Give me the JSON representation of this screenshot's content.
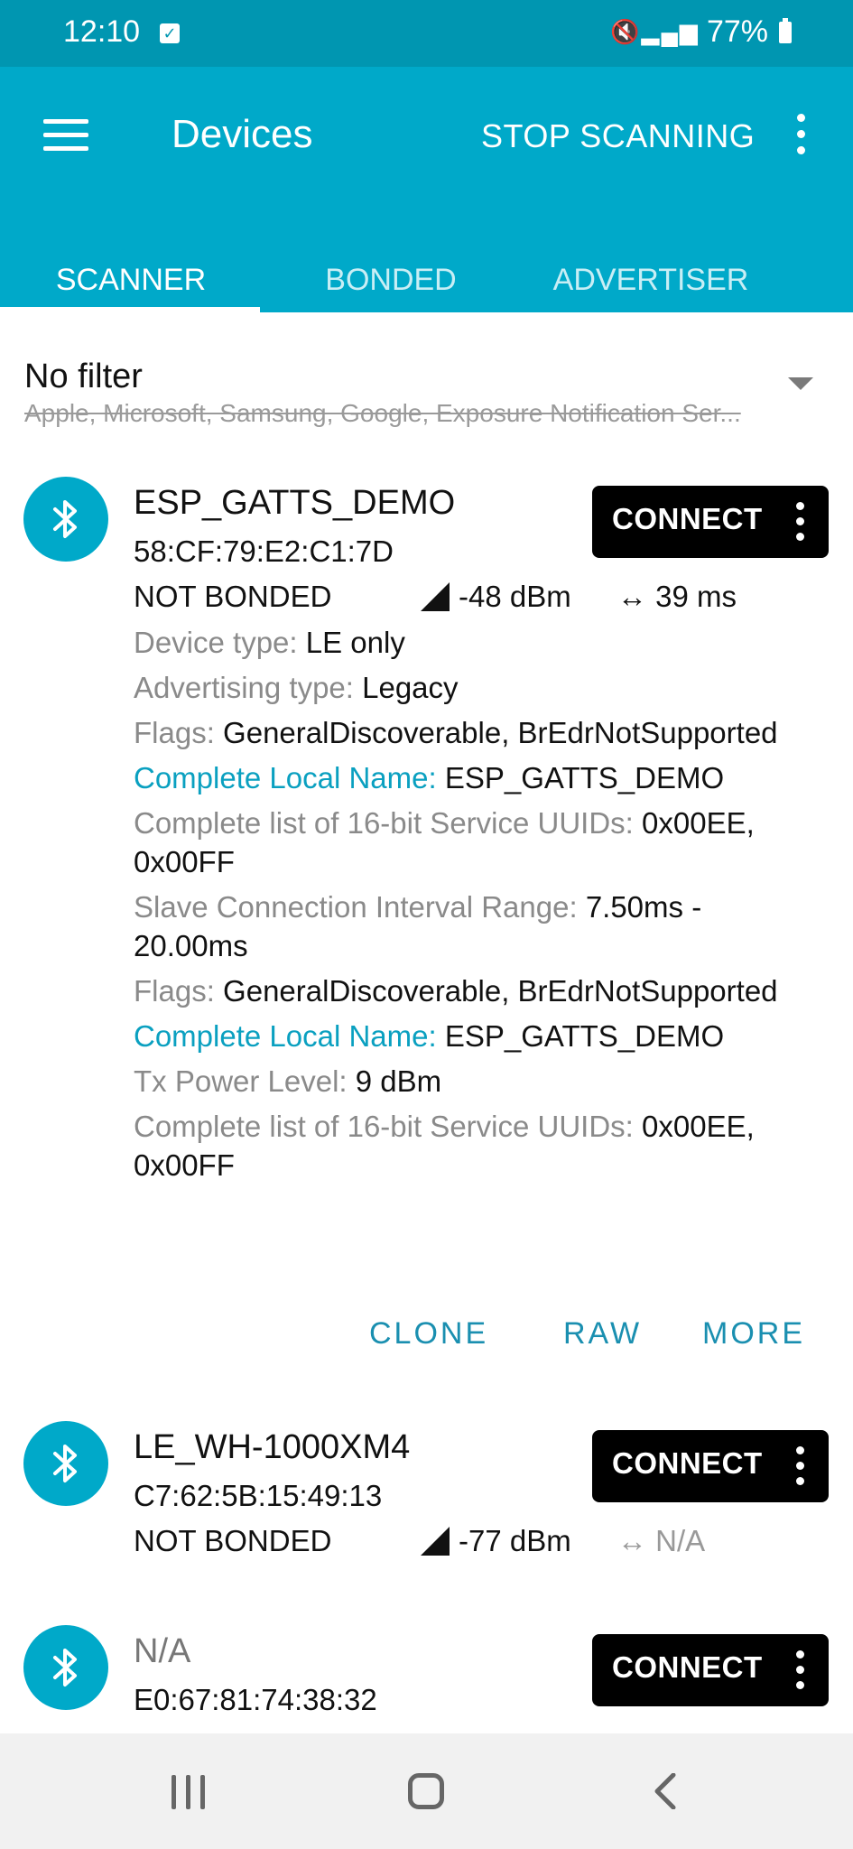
{
  "status_bar": {
    "time": "12:10",
    "battery": "77%",
    "icons": [
      "checkbox-notification-icon",
      "vibrate-mute-icon",
      "signal-icon",
      "battery-icon"
    ]
  },
  "app_bar": {
    "title": "Devices",
    "stop_scanning_label": "STOP SCANNING",
    "background_color": "#00a9c9"
  },
  "tabs": [
    {
      "label": "SCANNER",
      "active": true
    },
    {
      "label": "BONDED",
      "active": false
    },
    {
      "label": "ADVERTISER",
      "active": false
    }
  ],
  "filter": {
    "title": "No filter",
    "excluded": "Apple, Microsoft, Samsung, Google, Exposure Notification Ser..."
  },
  "devices": [
    {
      "name": "ESP_GATTS_DEMO",
      "address": "58:CF:79:E2:C1:7D",
      "bond_state": "NOT BONDED",
      "rssi": "-48 dBm",
      "interval": "39 ms",
      "connect_label": "CONNECT",
      "details": [
        {
          "key": "Device type: ",
          "value": "LE only"
        },
        {
          "key": "Advertising type: ",
          "value": "Legacy"
        },
        {
          "key": "Flags: ",
          "value": "GeneralDiscoverable, BrEdrNotSupported"
        },
        {
          "key": "Complete Local Name: ",
          "value": "ESP_GATTS_DEMO"
        },
        {
          "key": "Complete list of 16-bit Service UUIDs: ",
          "value": "0x00EE, 0x00FF"
        },
        {
          "key": "Slave Connection Interval Range: ",
          "value": "7.50ms - 20.00ms"
        },
        {
          "key": "Flags: ",
          "value": "GeneralDiscoverable, BrEdrNotSupported"
        },
        {
          "key": "Complete Local Name: ",
          "value": "ESP_GATTS_DEMO"
        },
        {
          "key": "Tx Power Level: ",
          "value": "9 dBm"
        },
        {
          "key": "Complete list of 16-bit Service UUIDs: ",
          "value": "0x00EE, 0x00FF"
        }
      ],
      "actions": [
        "CLONE",
        "RAW",
        "MORE"
      ]
    },
    {
      "name": "LE_WH-1000XM4",
      "address": "C7:62:5B:15:49:13",
      "bond_state": "NOT BONDED",
      "rssi": "-77 dBm",
      "interval": "N/A",
      "connect_label": "CONNECT"
    },
    {
      "name": "N/A",
      "address": "E0:67:81:74:38:32",
      "connect_label": "CONNECT"
    }
  ],
  "nav_bar": {
    "icons": [
      "recents-icon",
      "home-icon",
      "back-icon"
    ]
  }
}
